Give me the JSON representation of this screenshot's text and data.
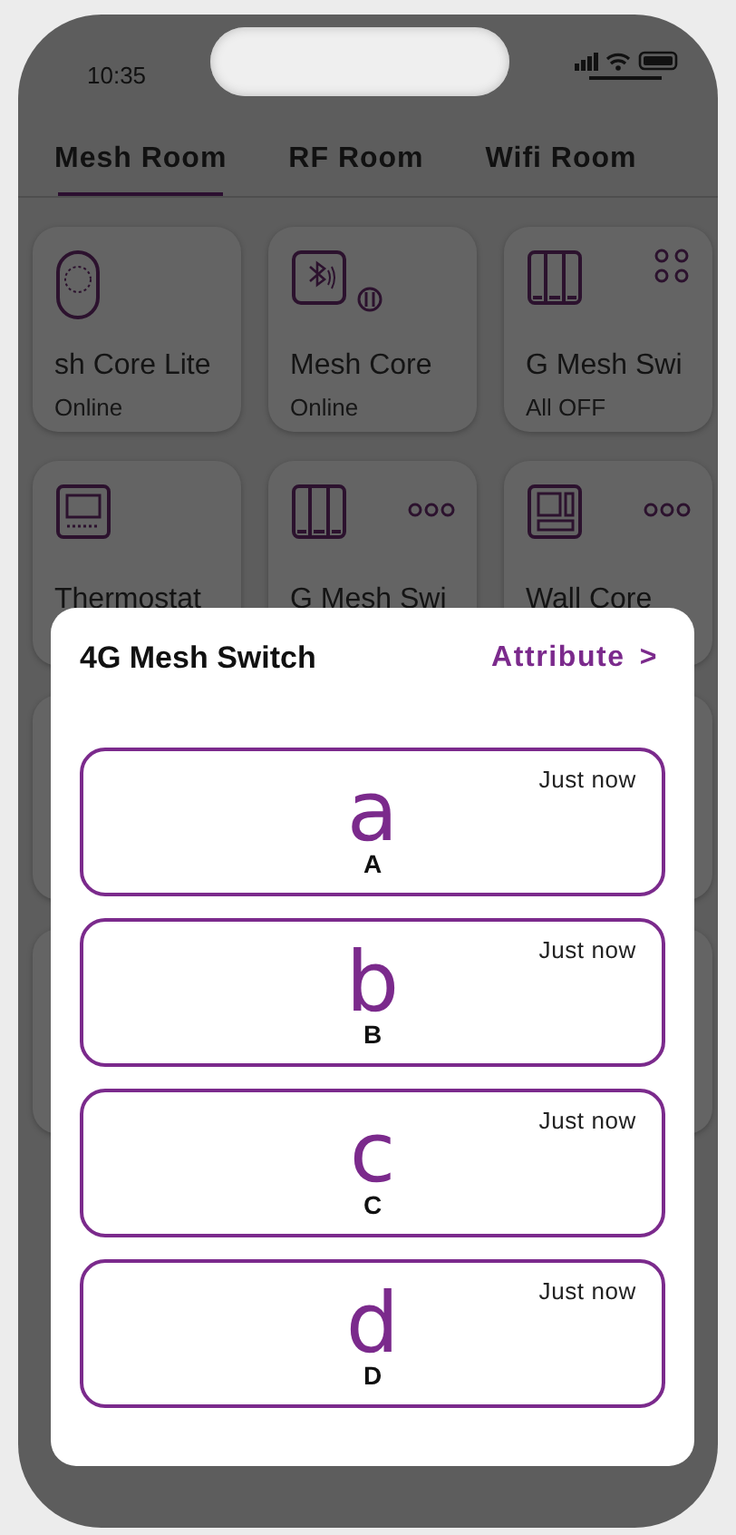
{
  "status_bar": {
    "time": "10:35"
  },
  "tabs": [
    {
      "label": "Mesh Room",
      "selected": true
    },
    {
      "label": "RF Room",
      "selected": false
    },
    {
      "label": "Wifi Room",
      "selected": false
    }
  ],
  "devices": [
    {
      "kind": "pebble",
      "name": "sh Core Lite",
      "status": "Online"
    },
    {
      "kind": "hub",
      "name": "Mesh Core",
      "status": "Online"
    },
    {
      "kind": "switch",
      "name": "G Mesh Swi",
      "status": "All OFF",
      "menu": {
        "kind": "dots"
      }
    },
    {
      "kind": "thermostat",
      "name": "Thermostat"
    },
    {
      "kind": "switch",
      "name": "G Mesh Swi",
      "menu": {
        "kind": "more"
      }
    },
    {
      "kind": "panel",
      "name": "Wall Core",
      "menu": {
        "kind": "more"
      }
    }
  ],
  "sheet": {
    "title": "4G Mesh Switch",
    "link": "Attribute",
    "link_icon": ">",
    "buttons": [
      {
        "glyph": "a",
        "label": "A",
        "time": "Just now"
      },
      {
        "glyph": "b",
        "label": "B",
        "time": "Just now"
      },
      {
        "glyph": "c",
        "label": "C",
        "time": "Just now"
      },
      {
        "glyph": "d",
        "label": "D",
        "time": "Just now"
      }
    ]
  }
}
